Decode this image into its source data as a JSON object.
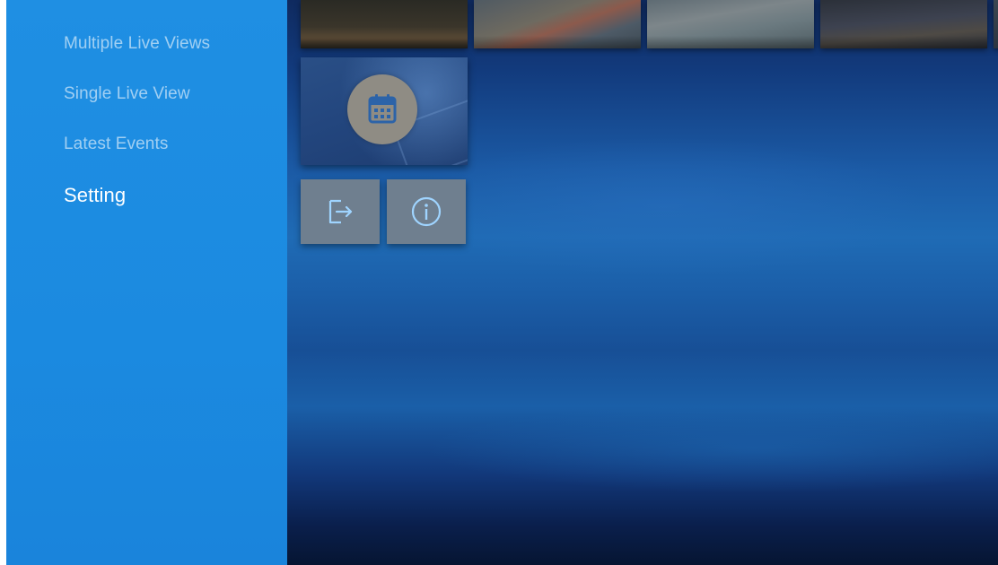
{
  "sidebar": {
    "items": [
      {
        "label": "Multiple Live Views",
        "active": false
      },
      {
        "label": "Single Live View",
        "active": false
      },
      {
        "label": "Latest Events",
        "active": false
      },
      {
        "label": "Setting",
        "active": true
      }
    ]
  },
  "content": {
    "thumbnails": [
      {
        "id": "camera-1"
      },
      {
        "id": "camera-2"
      },
      {
        "id": "camera-3"
      },
      {
        "id": "camera-4"
      },
      {
        "id": "camera-5"
      }
    ],
    "event_tile_icon": "calendar-icon",
    "actions": [
      {
        "icon": "logout-icon"
      },
      {
        "icon": "info-icon"
      }
    ]
  },
  "colors": {
    "sidebar_bg": "#1f8fe3",
    "nav_active": "#ffffff",
    "tile_button": "#6f7f8f",
    "icon_accent": "#9fd4ff"
  }
}
